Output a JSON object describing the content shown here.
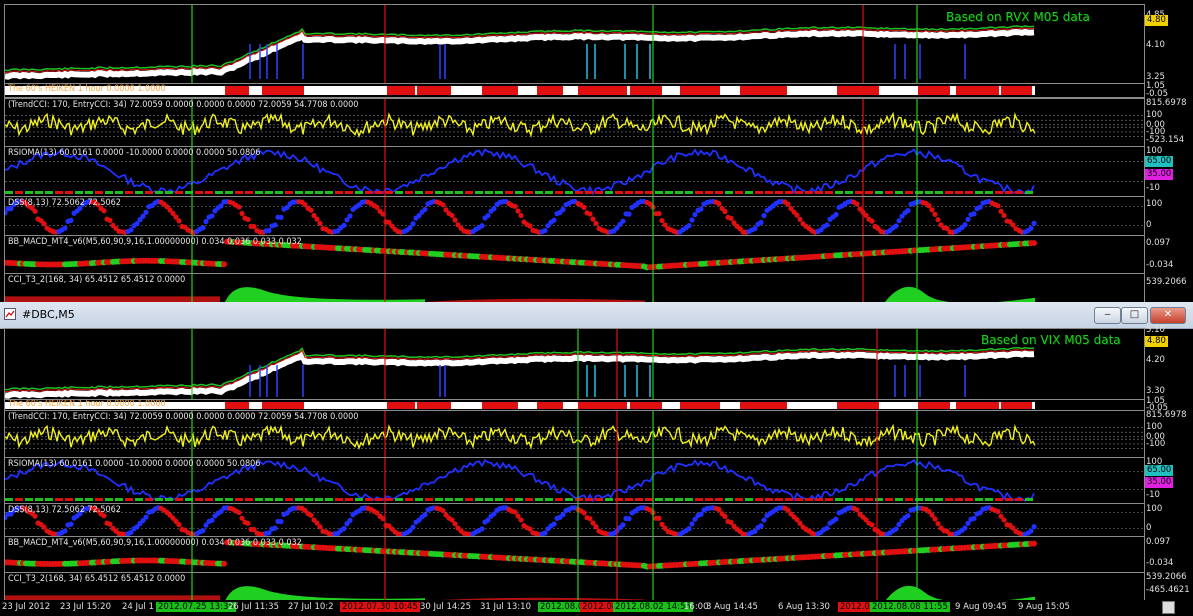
{
  "colors": {
    "accent_green": "#20d020",
    "accent_red": "#e01010",
    "price_white": "#ffffff",
    "yellow": "#f0f020",
    "blue": "#2020ff"
  },
  "window_top": {
    "caption": "Based on RVX M05 data",
    "price_tag": "4.80",
    "price_ticks": [
      "4.85",
      "4.10",
      "3.25"
    ],
    "heiken_label": "The 60's HEIKEN 1 hour 0.0000 1.0000",
    "heiken_ticks": [
      "1.05",
      "-0.05"
    ],
    "cci_label": "(TrendCCI: 170, EntryCCI: 34)  72.0059 0.0000 0.0000 0.0000 72.0059 54.7708 0.0000",
    "cci_ticks": [
      "815.6978",
      "100",
      "0.00",
      "-100",
      "-523.154"
    ],
    "rsioma_label": "RSIOMA(13) 60.0161 0.0000 -10.0000 0.0000 0.0000 50.0806",
    "rsioma_ticks": [
      "100",
      "65.00",
      "35.00",
      "-10"
    ],
    "dss_label": "DSS(8,13) 72.5062 72.5062",
    "dss_ticks": [
      "100",
      "0"
    ],
    "macd_label": "BB_MACD_MT4_v6(M5,60,90,9,16,1.00000000) 0.034 0.036 0.033 0.032",
    "macd_ticks": [
      "0.097",
      "-0.034"
    ],
    "cci3_label": "CCI_T3_2(168, 34) 65.4512 65.4512 0.0000",
    "cci3_ticks": [
      "539.2066"
    ]
  },
  "window_bottom": {
    "title": "#DBC,M5",
    "caption": "Based on VIX M05 data",
    "price_tag": "4.80",
    "price_ticks": [
      "5.10",
      "4.20",
      "3.30"
    ],
    "heiken_label": "The 60's HEIKEN 1 hour 0.0000 1.0000",
    "heiken_ticks": [
      "1.05",
      "-0.05"
    ],
    "cci_label": "(TrendCCI: 170, EntryCCI: 34)  72.0059 0.0000 0.0000 0.0000 72.0059 54.7708 0.0000",
    "cci_ticks": [
      "815.6978",
      "100",
      "0.00",
      "-100"
    ],
    "rsioma_label": "RSIOMA(13) 60.0161 0.0000 -10.0000 0.0000 0.0000 50.0806",
    "rsioma_ticks": [
      "100",
      "65.00",
      "35.00",
      "-10"
    ],
    "dss_label": "DSS(8,13) 72.5062 72.5062",
    "dss_ticks": [
      "100",
      "0"
    ],
    "macd_label": "BB_MACD_MT4_v6(M5,60,90,9,16,1.00000000) 0.034 0.036 0.033 0.032",
    "macd_ticks": [
      "0.097",
      "-0.034"
    ],
    "cci3_label": "CCI_T3_2(168, 34) 65.4512 65.4512 0.0000",
    "cci3_ticks": [
      "539.2066",
      "-465.4621"
    ]
  },
  "time_axis": [
    {
      "text": "23 Jul 2012",
      "style": "plain"
    },
    {
      "text": "23 Jul 15:20",
      "style": "plain"
    },
    {
      "text": "24 Jul 1",
      "style": "plain"
    },
    {
      "text": "2012.07.25 13:35",
      "style": "green"
    },
    {
      "text": "26 Jul 11:35",
      "style": "plain"
    },
    {
      "text": "27 Jul 10:2",
      "style": "plain"
    },
    {
      "text": "2012.07.30 10:45",
      "style": "red"
    },
    {
      "text": "30 Jul 14:25",
      "style": "plain"
    },
    {
      "text": "31 Jul 13:10",
      "style": "plain"
    },
    {
      "text": "2012.08.0",
      "style": "green"
    },
    {
      "text": "2012.08",
      "style": "red"
    },
    {
      "text": "2012.08.02 14:55",
      "style": "green"
    },
    {
      "text": "16:00",
      "style": "plain"
    },
    {
      "text": "3 Aug 14:45",
      "style": "plain"
    },
    {
      "text": "6 Aug 13:30",
      "style": "plain"
    },
    {
      "text": "2012.08",
      "style": "red"
    },
    {
      "text": "2012.08.08 11:55",
      "style": "green"
    },
    {
      "text": "9 Aug 09:45",
      "style": "plain"
    },
    {
      "text": "9 Aug 15:05",
      "style": "plain"
    }
  ],
  "window_buttons": {
    "minimize": "‒",
    "maximize": "□",
    "close": "✕"
  }
}
